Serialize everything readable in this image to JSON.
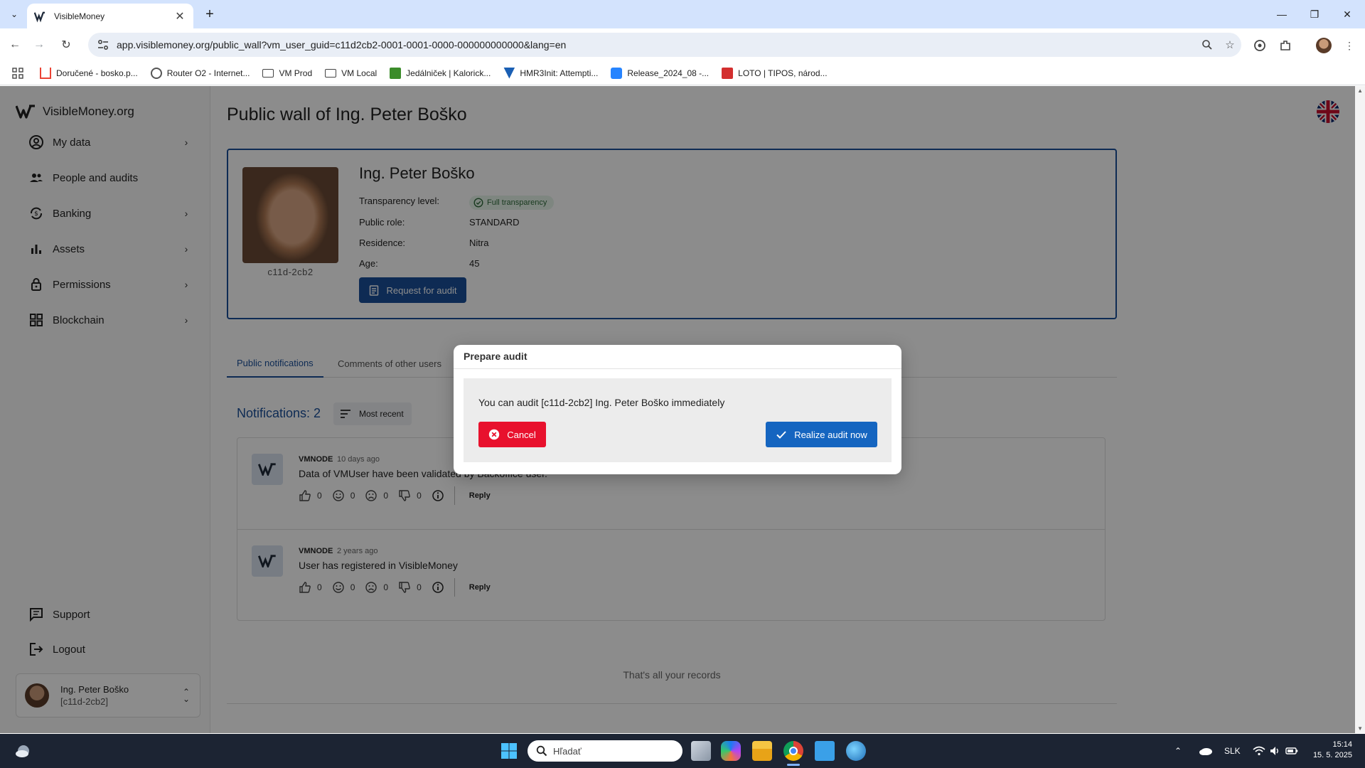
{
  "browser": {
    "tab_title": "VisibleMoney",
    "url": "app.visiblemoney.org/public_wall?vm_user_guid=c11d2cb2-0001-0001-0000-000000000000&lang=en",
    "bookmarks": [
      {
        "label": "Doručené - bosko.p...",
        "icon": "gmail-icon",
        "color": "#ea4335"
      },
      {
        "label": "Router O2 - Internet...",
        "icon": "globe-icon",
        "color": "#555555"
      },
      {
        "label": "VM Prod",
        "icon": "folder-icon",
        "color": "#444444"
      },
      {
        "label": "VM Local",
        "icon": "folder-icon",
        "color": "#444444"
      },
      {
        "label": "Jedálniček | Kalorick...",
        "icon": "checkbox-icon",
        "color": "#3b8c2a"
      },
      {
        "label": "HMR3Init: Attempti...",
        "icon": "vbox-icon",
        "color": "#1a5fb4"
      },
      {
        "label": "Release_2024_08 -...",
        "icon": "jira-icon",
        "color": "#2684ff"
      },
      {
        "label": "LOTO | TIPOS, národ...",
        "icon": "tipos-icon",
        "color": "#d32f2f"
      }
    ]
  },
  "sidebar": {
    "brand": "VisibleMoney.org",
    "items": [
      {
        "label": "My data",
        "icon": "account-circle-icon",
        "has_chevron": true
      },
      {
        "label": "People and audits",
        "icon": "people-icon",
        "has_chevron": false
      },
      {
        "label": "Banking",
        "icon": "bank-cycle-icon",
        "has_chevron": true
      },
      {
        "label": "Assets",
        "icon": "bar-chart-icon",
        "has_chevron": true
      },
      {
        "label": "Permissions",
        "icon": "lock-icon",
        "has_chevron": true
      },
      {
        "label": "Blockchain",
        "icon": "grid-icon",
        "has_chevron": true
      }
    ],
    "support": "Support",
    "logout": "Logout",
    "user": {
      "name": "Ing. Peter Boško",
      "id": "[c11d-2cb2]"
    }
  },
  "main": {
    "page_title": "Public wall of Ing. Peter Boško",
    "profile": {
      "name": "Ing. Peter Boško",
      "photo_id": "c11d-2cb2",
      "transparency_label": "Transparency level:",
      "transparency_value": "Full transparency",
      "role_label": "Public role:",
      "role_value": "STANDARD",
      "residence_label": "Residence:",
      "residence_value": "Nitra",
      "age_label": "Age:",
      "age_value": "45",
      "audit_button": "Request for audit"
    },
    "tabs": [
      {
        "label": "Public notifications",
        "active": true
      },
      {
        "label": "Comments of other users",
        "active": false
      }
    ],
    "notifications_title": "Notifications: 2",
    "sort_label": "Most recent",
    "posts": [
      {
        "author": "VMNODE",
        "time": "10 days ago",
        "text": "Data of VMUser have been validated by Backoffice user.",
        "likes": "0",
        "smiles": "0",
        "frowns": "0",
        "dislikes": "0",
        "reply": "Reply"
      },
      {
        "author": "VMNODE",
        "time": "2 years ago",
        "text": "User has registered in VisibleMoney",
        "likes": "0",
        "smiles": "0",
        "frowns": "0",
        "dislikes": "0",
        "reply": "Reply"
      }
    ],
    "end_text": "That's all your records"
  },
  "dialog": {
    "title": "Prepare audit",
    "message": "You can audit [c11d-2cb2] Ing. Peter Boško immediately",
    "cancel": "Cancel",
    "confirm": "Realize audit now"
  },
  "taskbar": {
    "search_placeholder": "Hľadať",
    "language": "SLK",
    "time": "15:14",
    "date": "15. 5. 2025"
  },
  "colors": {
    "accent": "#1a4f99",
    "danger": "#e8112d",
    "confirm": "#1565c0"
  }
}
